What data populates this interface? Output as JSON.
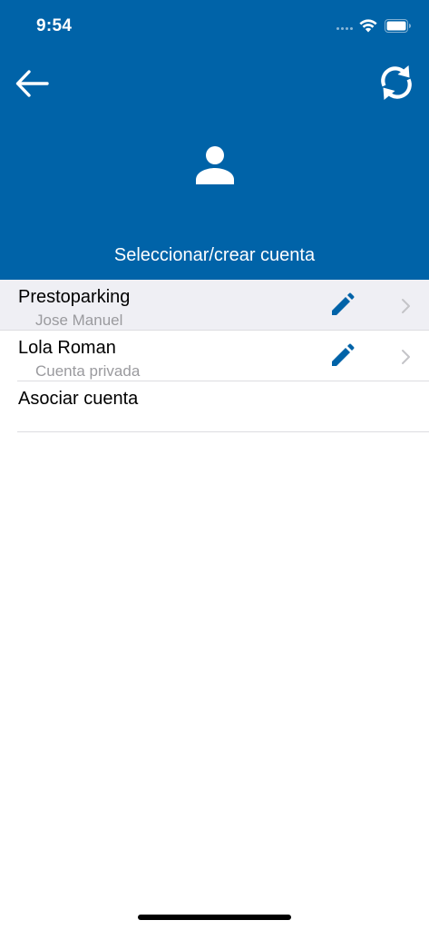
{
  "status_bar": {
    "time": "9:54"
  },
  "header": {
    "title": "Seleccionar/crear cuenta",
    "background_color": "#0063a8",
    "back_icon": "arrow-left-icon",
    "refresh_icon": "sync-icon",
    "avatar_icon": "person-icon"
  },
  "accounts": [
    {
      "name": "Prestoparking",
      "subtitle": "Jose Manuel",
      "selected": true
    },
    {
      "name": "Lola Roman",
      "subtitle": "Cuenta privada",
      "selected": false
    }
  ],
  "associate": {
    "label": "Asociar cuenta"
  },
  "accent_color": "#0063a8"
}
